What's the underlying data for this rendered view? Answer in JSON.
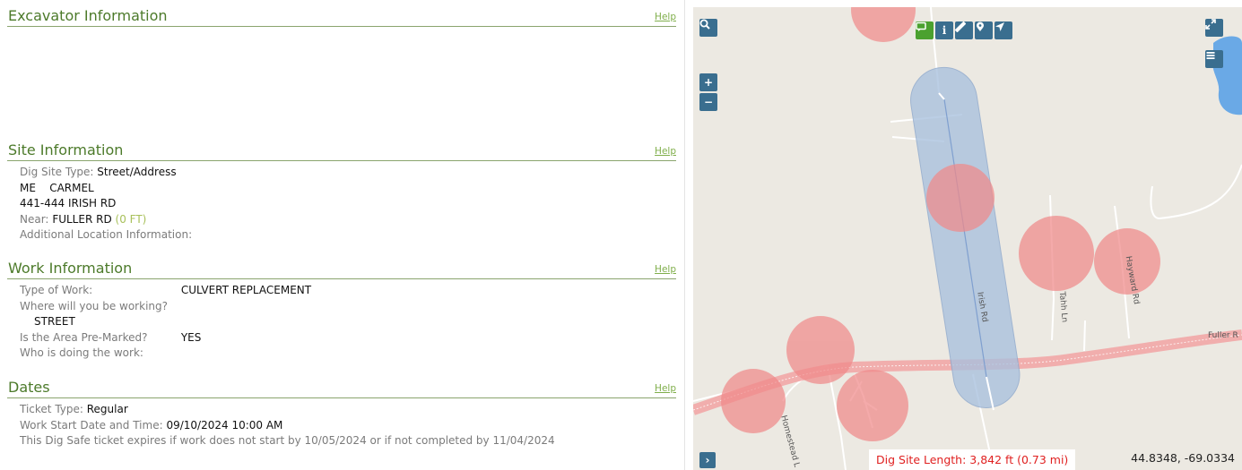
{
  "sections": {
    "excavator": {
      "title": "Excavator Information",
      "help": "Help"
    },
    "site": {
      "title": "Site Information",
      "help": "Help",
      "dig_site_type_label": "Dig Site Type:",
      "dig_site_type": "Street/Address",
      "state_town": "ME    CARMEL",
      "address": "441-444 IRISH RD",
      "near_label": "Near:",
      "near_value": "FULLER RD",
      "near_distance": "(0 FT)",
      "additional_label": "Additional Location Information:"
    },
    "work": {
      "title": "Work Information",
      "help": "Help",
      "type_label": "Type of Work:",
      "type_value": "CULVERT REPLACEMENT",
      "where_label": "Where will you be working?",
      "where_value": "STREET",
      "premarked_label": "Is the Area Pre-Marked?",
      "premarked_value": "YES",
      "who_label": "Who is doing the work:"
    },
    "dates": {
      "title": "Dates",
      "help": "Help",
      "ticket_type_label": "Ticket Type:",
      "ticket_type": "Regular",
      "start_label": "Work Start Date and Time:",
      "start_value": "09/10/2024 10:00 AM",
      "expire_note": "This Dig Safe ticket expires if work does not start by 10/05/2024 or if not completed by 11/04/2024"
    }
  },
  "map": {
    "dig_length": "Dig Site Length: 3,842 ft (0.73 mi)",
    "coords": "44.8348, -69.0334",
    "roads": {
      "irish": "Irish Rd",
      "tahh": "Tahh Ln",
      "hayward": "Hayward Rd",
      "fuller": "Fuller R",
      "homestead": "Homestead L"
    },
    "buttons": {
      "search": "search-icon",
      "zoom_in": "+",
      "zoom_out": "−",
      "expand": "expand-icon",
      "layers": "menu-icon",
      "collapse": "›"
    },
    "colors": {
      "buffer": "#a9c1de",
      "utility": "#f28c8c",
      "road": "#ffffff",
      "water": "#6aa9e6"
    }
  }
}
